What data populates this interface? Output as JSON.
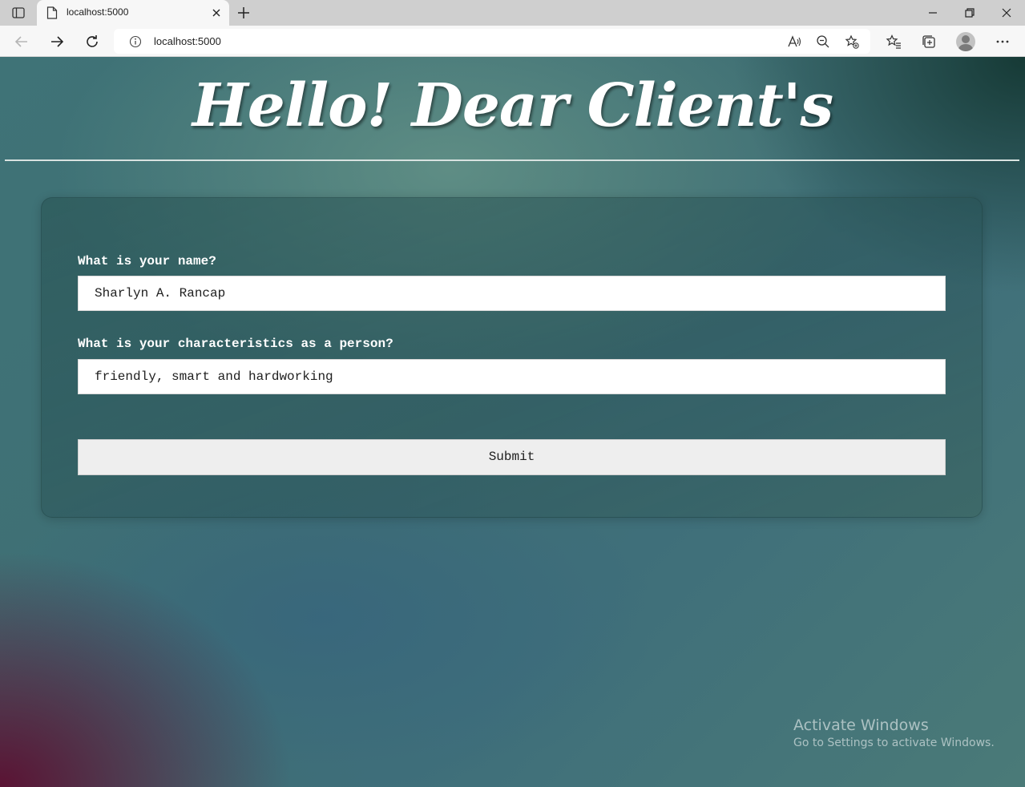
{
  "browser": {
    "tab_title": "localhost:5000",
    "url": "localhost:5000",
    "icons": [
      "tab-actions-icon",
      "page-favicon-icon",
      "close-tab-icon",
      "new-tab-icon",
      "minimize-icon",
      "restore-icon",
      "close-window-icon",
      "back-icon",
      "forward-icon",
      "refresh-icon",
      "site-info-icon",
      "read-aloud-icon",
      "zoom-out-icon",
      "add-favorite-icon",
      "favorites-icon",
      "collections-icon",
      "profile-icon",
      "more-icon"
    ]
  },
  "page": {
    "heading": "Hello! Dear Client's",
    "form": {
      "name_label": "What is your name?",
      "name_value": "Sharlyn A. Rancap",
      "characteristics_label": "What is your characteristics as a person?",
      "characteristics_value": "friendly, smart and hardworking",
      "submit_label": "Submit"
    }
  },
  "watermark": {
    "line1": "Activate Windows",
    "line2": "Go to Settings to activate Windows."
  },
  "colors": {
    "tabbar": "#cfcfcf",
    "toolbar": "#f7f7f7",
    "page_teal": "#3f7377",
    "page_maroon": "#5c0e30",
    "text_white": "#ffffff",
    "button_bg": "#eeeeee"
  }
}
